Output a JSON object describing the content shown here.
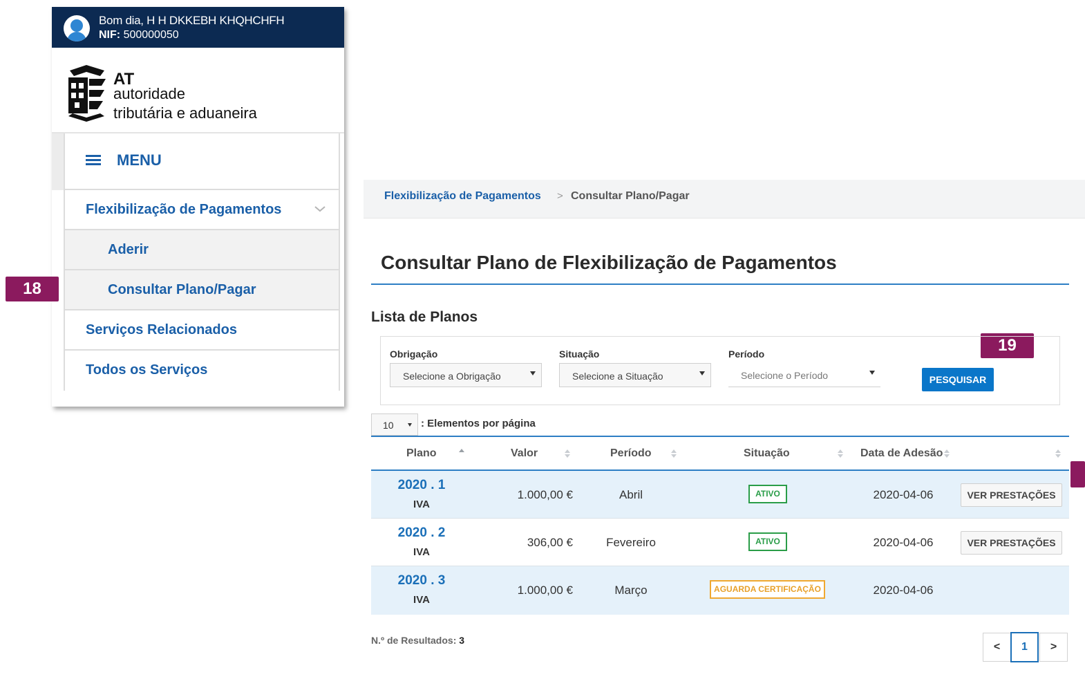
{
  "user": {
    "greeting": "Bom dia, H H DKKEBH KHQHCHFH",
    "nif_label": "NIF:",
    "nif_value": "500000050"
  },
  "logo": {
    "abbr": "AT",
    "line1": "autoridade",
    "line2": "tributária e aduaneira"
  },
  "menu": {
    "title": "MENU",
    "items": [
      {
        "label": "Flexibilização de Pagamentos"
      },
      {
        "label": "Aderir"
      },
      {
        "label": "Consultar Plano/Pagar"
      },
      {
        "label": "Serviços Relacionados"
      },
      {
        "label": "Todos os Serviços"
      }
    ]
  },
  "tags": {
    "t18": "18",
    "t19": "19"
  },
  "breadcrumb": {
    "parent": "Flexibilização de Pagamentos",
    "separator": ">",
    "current": "Consultar Plano/Pagar"
  },
  "page": {
    "title": "Consultar Plano de Flexibilização de Pagamentos",
    "list_title": "Lista de Planos"
  },
  "filters": {
    "obrigacao_label": "Obrigação",
    "obrigacao_value": "Selecione a Obrigação",
    "situacao_label": "Situação",
    "situacao_value": "Selecione a Situação",
    "periodo_label": "Período",
    "periodo_value": "Selecione o Período",
    "search_button": "PESQUISAR"
  },
  "pagination": {
    "per_page_value": "10",
    "per_page_label": ": Elementos por página",
    "results_label": "N.º de Resultados:",
    "results_count": "3",
    "prev": "<",
    "current": "1",
    "next": ">"
  },
  "table": {
    "columns": [
      "Plano",
      "Valor",
      "Período",
      "Situação",
      "Data de Adesão"
    ],
    "rows": [
      {
        "plano": "2020 . 1",
        "imposto": "IVA",
        "valor": "1.000,00 €",
        "periodo": "Abril",
        "situacao": "ATIVO",
        "data": "2020-04-06",
        "acao": "VER PRESTAÇÕES"
      },
      {
        "plano": "2020 . 2",
        "imposto": "IVA",
        "valor": "306,00 €",
        "periodo": "Fevereiro",
        "situacao": "ATIVO",
        "data": "2020-04-06",
        "acao": "VER PRESTAÇÕES"
      },
      {
        "plano": "2020 . 3",
        "imposto": "IVA",
        "valor": "1.000,00 €",
        "periodo": "Março",
        "situacao": "AGUARDA CERTIFICAÇÃO",
        "data": "2020-04-06",
        "acao": ""
      }
    ]
  },
  "colors": {
    "header_navy": "#0c2a52",
    "link_blue": "#1a5fa8",
    "primary_button": "#0a76c9",
    "tag_purple": "#8b1a5e",
    "status_active": "#2a9d48",
    "status_pending": "#f0a830"
  },
  "icons": [
    "user-avatar-icon",
    "at-logo-icon",
    "menu-hamburger-icon",
    "chevron-down-icon",
    "dropdown-arrow-icon",
    "sort-icon"
  ]
}
